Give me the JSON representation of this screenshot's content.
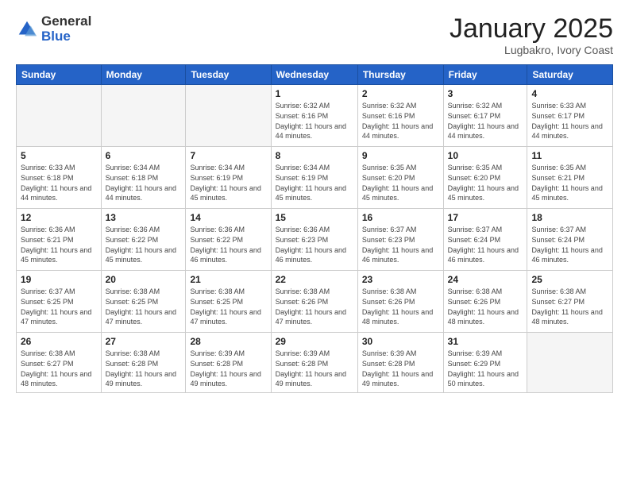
{
  "logo": {
    "general": "General",
    "blue": "Blue"
  },
  "header": {
    "month": "January 2025",
    "location": "Lugbakro, Ivory Coast"
  },
  "weekdays": [
    "Sunday",
    "Monday",
    "Tuesday",
    "Wednesday",
    "Thursday",
    "Friday",
    "Saturday"
  ],
  "weeks": [
    [
      {
        "day": "",
        "info": ""
      },
      {
        "day": "",
        "info": ""
      },
      {
        "day": "",
        "info": ""
      },
      {
        "day": "1",
        "info": "Sunrise: 6:32 AM\nSunset: 6:16 PM\nDaylight: 11 hours and 44 minutes."
      },
      {
        "day": "2",
        "info": "Sunrise: 6:32 AM\nSunset: 6:16 PM\nDaylight: 11 hours and 44 minutes."
      },
      {
        "day": "3",
        "info": "Sunrise: 6:32 AM\nSunset: 6:17 PM\nDaylight: 11 hours and 44 minutes."
      },
      {
        "day": "4",
        "info": "Sunrise: 6:33 AM\nSunset: 6:17 PM\nDaylight: 11 hours and 44 minutes."
      }
    ],
    [
      {
        "day": "5",
        "info": "Sunrise: 6:33 AM\nSunset: 6:18 PM\nDaylight: 11 hours and 44 minutes."
      },
      {
        "day": "6",
        "info": "Sunrise: 6:34 AM\nSunset: 6:18 PM\nDaylight: 11 hours and 44 minutes."
      },
      {
        "day": "7",
        "info": "Sunrise: 6:34 AM\nSunset: 6:19 PM\nDaylight: 11 hours and 45 minutes."
      },
      {
        "day": "8",
        "info": "Sunrise: 6:34 AM\nSunset: 6:19 PM\nDaylight: 11 hours and 45 minutes."
      },
      {
        "day": "9",
        "info": "Sunrise: 6:35 AM\nSunset: 6:20 PM\nDaylight: 11 hours and 45 minutes."
      },
      {
        "day": "10",
        "info": "Sunrise: 6:35 AM\nSunset: 6:20 PM\nDaylight: 11 hours and 45 minutes."
      },
      {
        "day": "11",
        "info": "Sunrise: 6:35 AM\nSunset: 6:21 PM\nDaylight: 11 hours and 45 minutes."
      }
    ],
    [
      {
        "day": "12",
        "info": "Sunrise: 6:36 AM\nSunset: 6:21 PM\nDaylight: 11 hours and 45 minutes."
      },
      {
        "day": "13",
        "info": "Sunrise: 6:36 AM\nSunset: 6:22 PM\nDaylight: 11 hours and 45 minutes."
      },
      {
        "day": "14",
        "info": "Sunrise: 6:36 AM\nSunset: 6:22 PM\nDaylight: 11 hours and 46 minutes."
      },
      {
        "day": "15",
        "info": "Sunrise: 6:36 AM\nSunset: 6:23 PM\nDaylight: 11 hours and 46 minutes."
      },
      {
        "day": "16",
        "info": "Sunrise: 6:37 AM\nSunset: 6:23 PM\nDaylight: 11 hours and 46 minutes."
      },
      {
        "day": "17",
        "info": "Sunrise: 6:37 AM\nSunset: 6:24 PM\nDaylight: 11 hours and 46 minutes."
      },
      {
        "day": "18",
        "info": "Sunrise: 6:37 AM\nSunset: 6:24 PM\nDaylight: 11 hours and 46 minutes."
      }
    ],
    [
      {
        "day": "19",
        "info": "Sunrise: 6:37 AM\nSunset: 6:25 PM\nDaylight: 11 hours and 47 minutes."
      },
      {
        "day": "20",
        "info": "Sunrise: 6:38 AM\nSunset: 6:25 PM\nDaylight: 11 hours and 47 minutes."
      },
      {
        "day": "21",
        "info": "Sunrise: 6:38 AM\nSunset: 6:25 PM\nDaylight: 11 hours and 47 minutes."
      },
      {
        "day": "22",
        "info": "Sunrise: 6:38 AM\nSunset: 6:26 PM\nDaylight: 11 hours and 47 minutes."
      },
      {
        "day": "23",
        "info": "Sunrise: 6:38 AM\nSunset: 6:26 PM\nDaylight: 11 hours and 48 minutes."
      },
      {
        "day": "24",
        "info": "Sunrise: 6:38 AM\nSunset: 6:26 PM\nDaylight: 11 hours and 48 minutes."
      },
      {
        "day": "25",
        "info": "Sunrise: 6:38 AM\nSunset: 6:27 PM\nDaylight: 11 hours and 48 minutes."
      }
    ],
    [
      {
        "day": "26",
        "info": "Sunrise: 6:38 AM\nSunset: 6:27 PM\nDaylight: 11 hours and 48 minutes."
      },
      {
        "day": "27",
        "info": "Sunrise: 6:38 AM\nSunset: 6:28 PM\nDaylight: 11 hours and 49 minutes."
      },
      {
        "day": "28",
        "info": "Sunrise: 6:39 AM\nSunset: 6:28 PM\nDaylight: 11 hours and 49 minutes."
      },
      {
        "day": "29",
        "info": "Sunrise: 6:39 AM\nSunset: 6:28 PM\nDaylight: 11 hours and 49 minutes."
      },
      {
        "day": "30",
        "info": "Sunrise: 6:39 AM\nSunset: 6:28 PM\nDaylight: 11 hours and 49 minutes."
      },
      {
        "day": "31",
        "info": "Sunrise: 6:39 AM\nSunset: 6:29 PM\nDaylight: 11 hours and 50 minutes."
      },
      {
        "day": "",
        "info": ""
      }
    ]
  ]
}
